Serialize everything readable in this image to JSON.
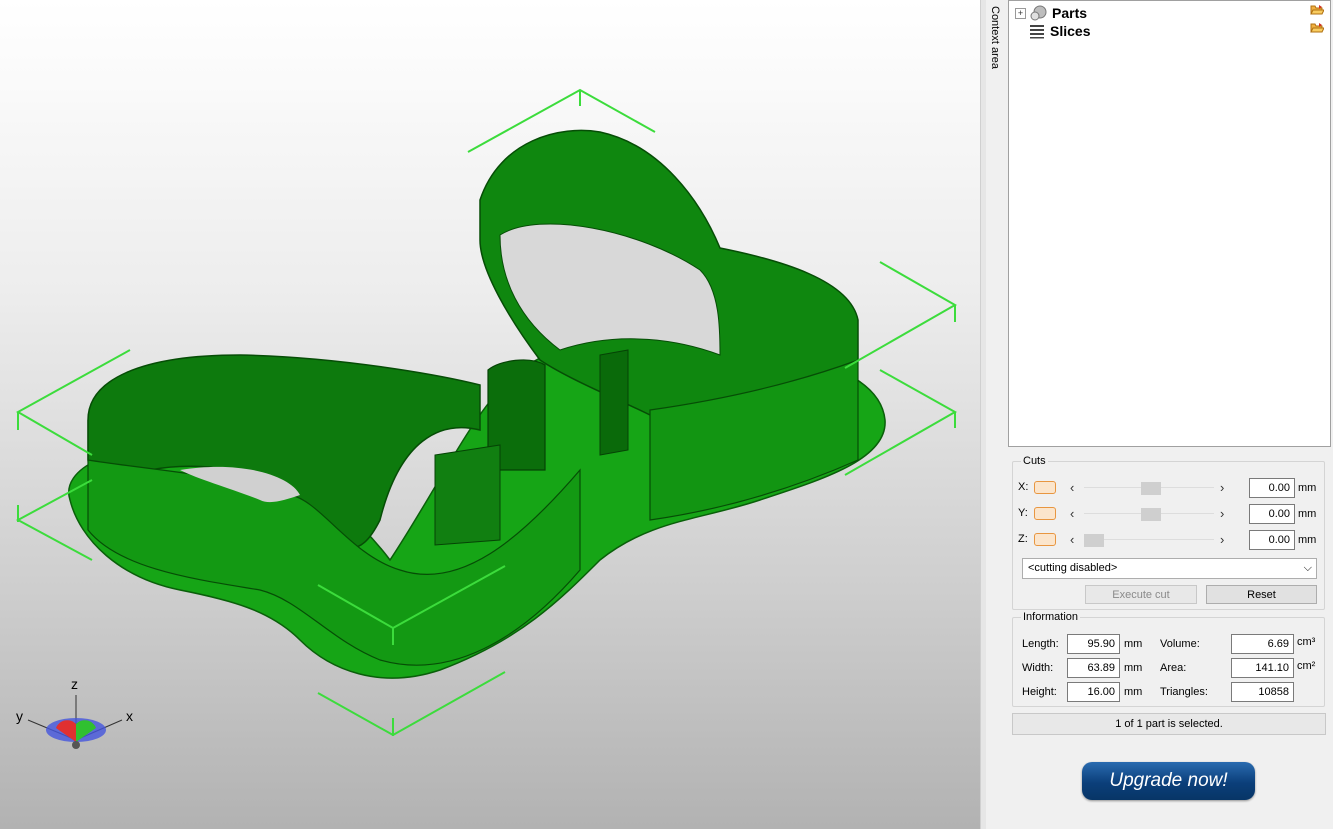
{
  "viewport": {
    "axes": {
      "x": "x",
      "y": "y",
      "z": "z"
    },
    "model_color": "#1fb81f",
    "selection_color": "#3cdc3c"
  },
  "context_tab": {
    "label": "Context area"
  },
  "tree": {
    "items": [
      {
        "label": "Parts",
        "icon": "parts-icon",
        "expandable": true
      },
      {
        "label": "Slices",
        "icon": "slices-icon",
        "expandable": false
      }
    ]
  },
  "cuts": {
    "title": "Cuts",
    "rows": [
      {
        "axis": "X:",
        "value": "0.00",
        "unit": "mm",
        "slider_pos": 0.5
      },
      {
        "axis": "Y:",
        "value": "0.00",
        "unit": "mm",
        "slider_pos": 0.5
      },
      {
        "axis": "Z:",
        "value": "0.00",
        "unit": "mm",
        "slider_pos": 0.0
      }
    ],
    "mode": "<cutting disabled>",
    "execute_label": "Execute cut",
    "reset_label": "Reset"
  },
  "information": {
    "title": "Information",
    "length_label": "Length:",
    "length": "95.90",
    "length_unit": "mm",
    "width_label": "Width:",
    "width": "63.89",
    "width_unit": "mm",
    "height_label": "Height:",
    "height": "16.00",
    "height_unit": "mm",
    "volume_label": "Volume:",
    "volume": "6.69",
    "volume_unit": "cm³",
    "area_label": "Area:",
    "area": "141.10",
    "area_unit": "cm²",
    "triangles_label": "Triangles:",
    "triangles": "10858"
  },
  "status": "1 of 1 part is selected.",
  "upgrade": {
    "label": "Upgrade now!"
  }
}
